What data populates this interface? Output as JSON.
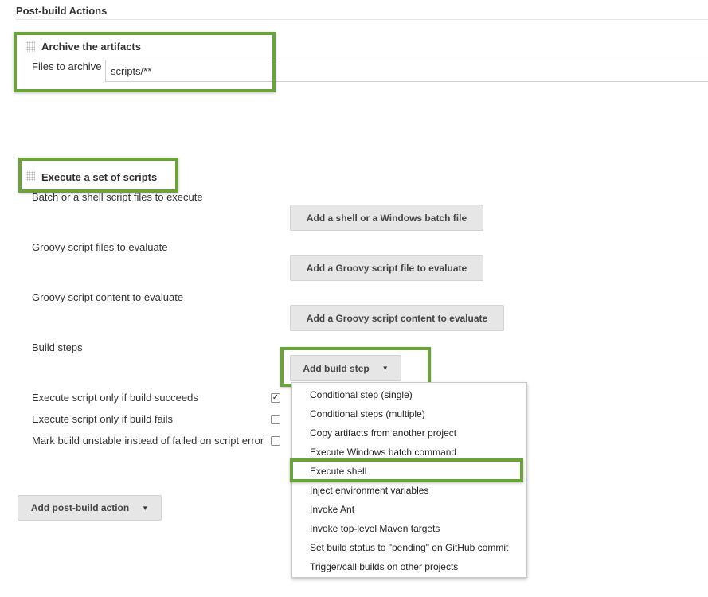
{
  "section": {
    "title": "Post-build Actions"
  },
  "archive": {
    "title": "Archive the artifacts",
    "files_label": "Files to archive",
    "files_value": "scripts/**"
  },
  "scripts": {
    "title": "Execute a set of scripts",
    "shell_label": "Batch or a shell script files to execute",
    "shell_button": "Add a shell or a Windows batch file",
    "groovy_files_label": "Groovy script files to evaluate",
    "groovy_files_button": "Add a Groovy script file to evaluate",
    "groovy_content_label": "Groovy script content to evaluate",
    "groovy_content_button": "Add a Groovy script content to evaluate",
    "build_steps_label": "Build steps",
    "build_step_button": "Add build step",
    "options": [
      {
        "label": "Execute script only if build succeeds",
        "checked": true
      },
      {
        "label": "Execute script only if build fails",
        "checked": false
      },
      {
        "label": "Mark build unstable instead of failed on script error",
        "checked": false
      }
    ]
  },
  "post_build_button": "Add post-build action",
  "build_step_menu": {
    "items": [
      "Conditional step (single)",
      "Conditional steps (multiple)",
      "Copy artifacts from another project",
      "Execute Windows batch command",
      "Execute shell",
      "Inject environment variables",
      "Invoke Ant",
      "Invoke top-level Maven targets",
      "Set build status to \"pending\" on GitHub commit",
      "Trigger/call builds on other projects"
    ],
    "highlighted": "Execute shell"
  },
  "colors": {
    "highlight_border": "#6aa33a",
    "button_bg": "#e6e6e6",
    "text": "#333333"
  }
}
